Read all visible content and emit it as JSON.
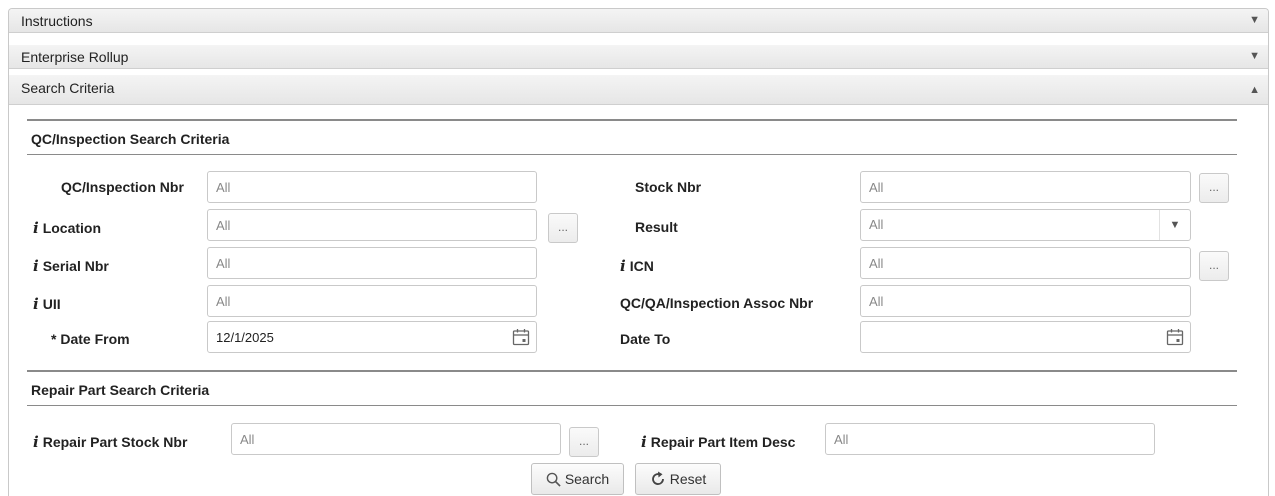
{
  "accordion": {
    "instructions": {
      "title": "Instructions",
      "arrow": "▼"
    },
    "enterprise_rollup": {
      "title": "Enterprise Rollup",
      "arrow": "▼"
    },
    "search_criteria": {
      "title": "Search Criteria",
      "arrow": "▲"
    }
  },
  "qc_section": {
    "title": "QC/Inspection Search Criteria",
    "fields": {
      "qc_inspection_nbr": {
        "label": "QC/Inspection Nbr",
        "placeholder": "All",
        "value": ""
      },
      "location": {
        "label": "Location",
        "placeholder": "All",
        "value": ""
      },
      "serial_nbr": {
        "label": "Serial Nbr",
        "placeholder": "All",
        "value": ""
      },
      "uii": {
        "label": "UII",
        "placeholder": "All",
        "value": ""
      },
      "date_from": {
        "label": "* Date From",
        "value": "12/1/2025"
      },
      "stock_nbr": {
        "label": "Stock Nbr",
        "placeholder": "All",
        "value": ""
      },
      "result": {
        "label": "Result",
        "selected": "All"
      },
      "icn": {
        "label": "ICN",
        "placeholder": "All",
        "value": ""
      },
      "qa_assoc_nbr": {
        "label": "QC/QA/Inspection Assoc Nbr",
        "placeholder": "All",
        "value": ""
      },
      "date_to": {
        "label": "Date To",
        "value": ""
      }
    }
  },
  "repair_section": {
    "title": "Repair Part Search Criteria",
    "fields": {
      "repair_stock_nbr": {
        "label": "Repair Part Stock Nbr",
        "placeholder": "All",
        "value": ""
      },
      "repair_item_desc": {
        "label": "Repair Part Item Desc",
        "placeholder": "All",
        "value": ""
      }
    }
  },
  "icons": {
    "info": "i",
    "lookup": "...",
    "dropdown": "▼"
  },
  "actions": {
    "search_label": "Search",
    "reset_label": "Reset"
  }
}
